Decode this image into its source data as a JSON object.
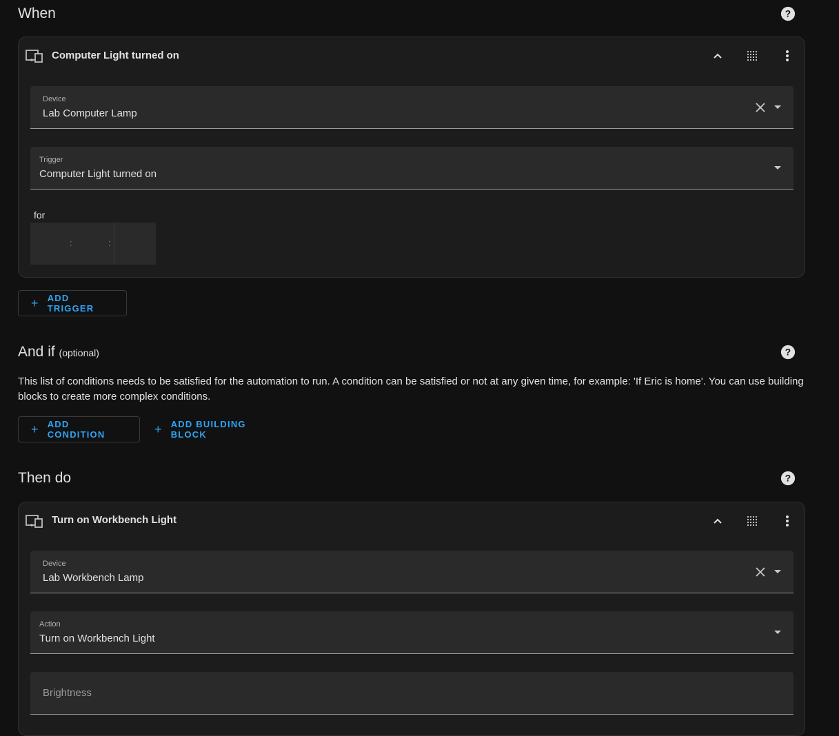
{
  "when": {
    "title": "When",
    "trigger_card": {
      "title": "Computer Light turned on",
      "device_label": "Device",
      "device_value": "Lab Computer Lamp",
      "trigger_label": "Trigger",
      "trigger_value": "Computer Light turned on",
      "for_label": "for",
      "duration_separator": ":"
    },
    "add_trigger": "ADD TRIGGER"
  },
  "and_if": {
    "title": "And if",
    "optional": "(optional)",
    "description": "This list of conditions needs to be satisfied for the automation to run. A condition can be satisfied or not at any given time, for example: 'If Eric is home'. You can use building blocks to create more complex conditions.",
    "add_condition": "ADD CONDITION",
    "add_building_block": "ADD BUILDING BLOCK"
  },
  "then_do": {
    "title": "Then do",
    "action_card": {
      "title": "Turn on Workbench Light",
      "device_label": "Device",
      "device_value": "Lab Workbench Lamp",
      "action_label": "Action",
      "action_value": "Turn on Workbench Light",
      "brightness_placeholder": "Brightness"
    }
  },
  "button_plus": "+",
  "icons": [
    "help-icon",
    "device-icon",
    "chevron-up-icon",
    "drag-handle-icon",
    "more-vert-icon",
    "clear-icon",
    "dropdown-icon"
  ],
  "colors": {
    "background": "#111111",
    "card": "#1c1c1c",
    "field": "#2a2a2a",
    "accent": "#2fa4f5",
    "text": "#e1e1e1"
  }
}
